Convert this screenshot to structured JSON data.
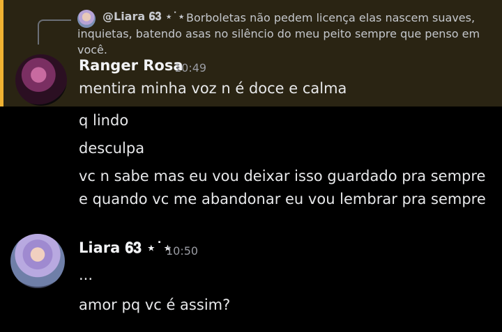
{
  "reply": {
    "author": "@Liara 𝟔𝟑 ⋆˙⋆",
    "text": "Borboletas não pedem licença elas nascem suaves, inquietas, batendo asas no silêncio do meu peito sempre que penso em você."
  },
  "messages": [
    {
      "author": "Ranger Rosa",
      "time": "10:49",
      "lines": [
        "mentira minha voz n é doce e calma",
        "q lindo",
        "desculpa",
        "vc n sabe mas eu vou deixar isso guardado pra sempre e quando vc me abandonar eu vou lembrar pra sempre"
      ]
    },
    {
      "author": "Liara 𝟔𝟑 ⋆˙⋆",
      "time": "10:50",
      "lines": [
        "...",
        "amor pq vc é assim?"
      ]
    }
  ],
  "colors": {
    "highlight_background": "#2a2413",
    "highlight_bar": "#f0b232",
    "background": "#000000"
  }
}
